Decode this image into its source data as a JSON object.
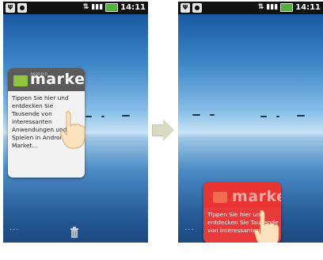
{
  "status_bar": {
    "time": "14:11",
    "signal_icon": "signal-bars-icon",
    "battery_icon": "battery-icon",
    "network_icon": "network-icon",
    "usb_icon": "usb-icon",
    "notification_icon": "android-notification-icon"
  },
  "left_screen": {
    "card": {
      "logo_subtitle": "ANDROID",
      "logo_text": "market",
      "message": "Tippen Sie hier und entdecken Sie Tausende von interessanten Anwendungen und Spielen in Android Market..."
    },
    "dock": {
      "dots": "···",
      "trash_icon": "trash-icon"
    }
  },
  "right_screen": {
    "card": {
      "logo_text": "market",
      "message": "Tippen Sie hier und entdecken Sie Tausende von interessanten"
    },
    "dock": {
      "dots": "···"
    }
  },
  "colors": {
    "status_bar": "#111111",
    "market_green": "#8fc43f",
    "highlight_red": "#e83a3a",
    "arrow": "#d8dbc1"
  }
}
